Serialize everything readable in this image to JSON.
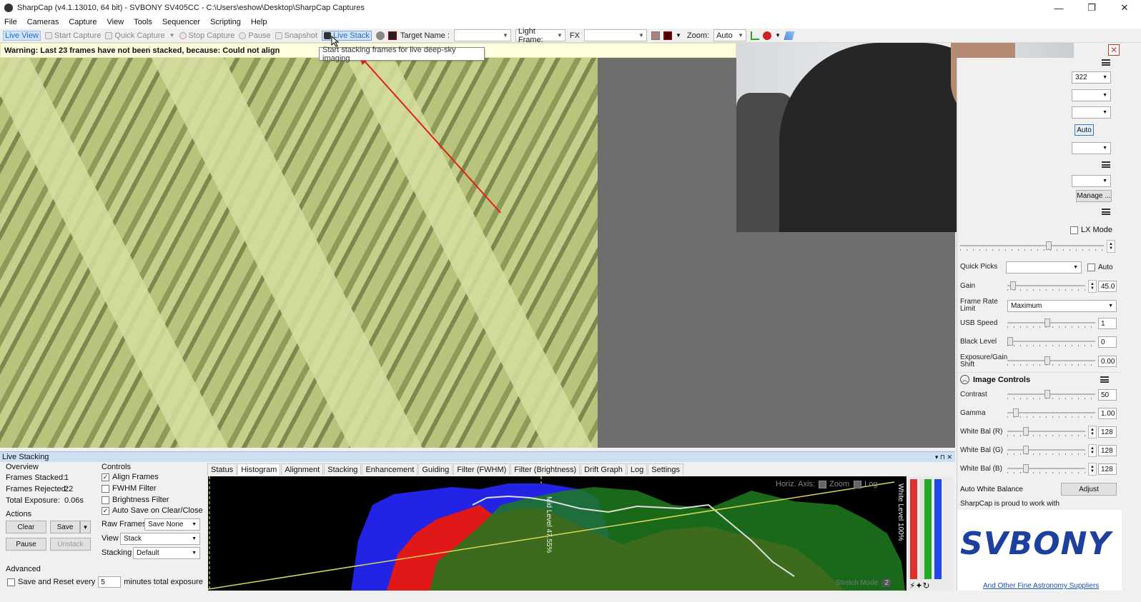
{
  "window": {
    "title": "SharpCap (v4.1.13010, 64 bit) - SVBONY SV405CC - C:\\Users\\eshow\\Desktop\\SharpCap Captures",
    "min": "—",
    "max": "❐",
    "close": "✕"
  },
  "menu": [
    "File",
    "Cameras",
    "Capture",
    "View",
    "Tools",
    "Sequencer",
    "Scripting",
    "Help"
  ],
  "toolbar": {
    "live_view": "Live View",
    "start_capture": "Start Capture",
    "quick_capture": "Quick Capture",
    "stop_capture": "Stop Capture",
    "pause": "Pause",
    "snapshot": "Snapshot",
    "live_stack": "Live Stack",
    "target_name_label": "Target Name :",
    "target_name_value": "",
    "frame_type": "Light Frame:",
    "fx_label": "FX",
    "fx_value": "",
    "zoom_label": "Zoom:",
    "zoom_value": "Auto"
  },
  "warning": {
    "text": "Warning: Last 23 frames have not been stacked, because: Could not align",
    "close": "✕"
  },
  "tooltip": "Start stacking frames for live deep-sky imaging",
  "colors": {
    "accent": "#2a6cc0",
    "arrow": "#e02020",
    "warning_bg": "#ffffe0",
    "brand": "#1d3f9e"
  },
  "right_panel": {
    "combo_322": "322",
    "auto_btn": "Auto",
    "manage_btn": "Manage ...",
    "lx_mode": "LX Mode",
    "quick_picks_label": "Quick Picks",
    "quick_picks_auto": "Auto",
    "gain_label": "Gain",
    "gain_value": "45.0",
    "frame_rate_label": "Frame Rate Limit",
    "frame_rate_value": "Maximum",
    "usb_speed_label": "USB Speed",
    "usb_speed_value": "1",
    "black_level_label": "Black Level",
    "black_level_value": "0",
    "exposure_gain_label": "Exposure/Gain Shift",
    "exposure_gain_value": "0.00",
    "image_controls_title": "Image Controls",
    "contrast_label": "Contrast",
    "contrast_value": "50",
    "gamma_label": "Gamma",
    "gamma_value": "1.00",
    "wb_r_label": "White Bal (R)",
    "wb_r_value": "128",
    "wb_g_label": "White Bal (G)",
    "wb_g_value": "128",
    "wb_b_label": "White Bal (B)",
    "wb_b_value": "128",
    "awb_label": "Auto White Balance",
    "adjust_btn": "Adjust",
    "proud_text": "SharpCap is proud to work with",
    "brand_logo": "SVBONY",
    "suppliers_link": "And Other Fine Astronomy Suppliers"
  },
  "live_stacking": {
    "header": "Live Stacking",
    "overview_title": "Overview",
    "frames_stacked_label": "Frames Stacked:",
    "frames_stacked": "1",
    "frames_rejected_label": "Frames Rejected:",
    "frames_rejected": "22",
    "total_exposure_label": "Total Exposure:",
    "total_exposure": "0.06s",
    "actions_title": "Actions",
    "clear_btn": "Clear",
    "save_btn": "Save",
    "pause_btn": "Pause",
    "unstack_btn": "Unstack",
    "advanced_title": "Advanced",
    "save_reset_label": "Save and Reset every",
    "save_reset_value": "5",
    "save_reset_suffix": "minutes total exposure",
    "controls_title": "Controls",
    "align_frames": "Align Frames",
    "fwhm_filter": "FWHM Filter",
    "brightness_filter": "Brightness Filter",
    "auto_save": "Auto Save on Clear/Close",
    "raw_frames_label": "Raw Frames",
    "raw_frames_value": "Save None",
    "view_label": "View",
    "view_value": "Stack",
    "stacking_label": "Stacking",
    "stacking_value": "Default",
    "tabs": [
      "Status",
      "Histogram",
      "Alignment",
      "Stacking",
      "Enhancement",
      "Guiding",
      "Filter (FWHM)",
      "Filter (Brightness)",
      "Drift Graph",
      "Log",
      "Settings"
    ],
    "histogram": {
      "horiz_axis": "Horiz. Axis:",
      "zoom": "Zoom",
      "log": "Log",
      "mid_level": "Mid Level 47.55%",
      "white_level": "White Level 100%",
      "stretch_mode": "Stretch Mode",
      "stretch_value": "2"
    }
  }
}
